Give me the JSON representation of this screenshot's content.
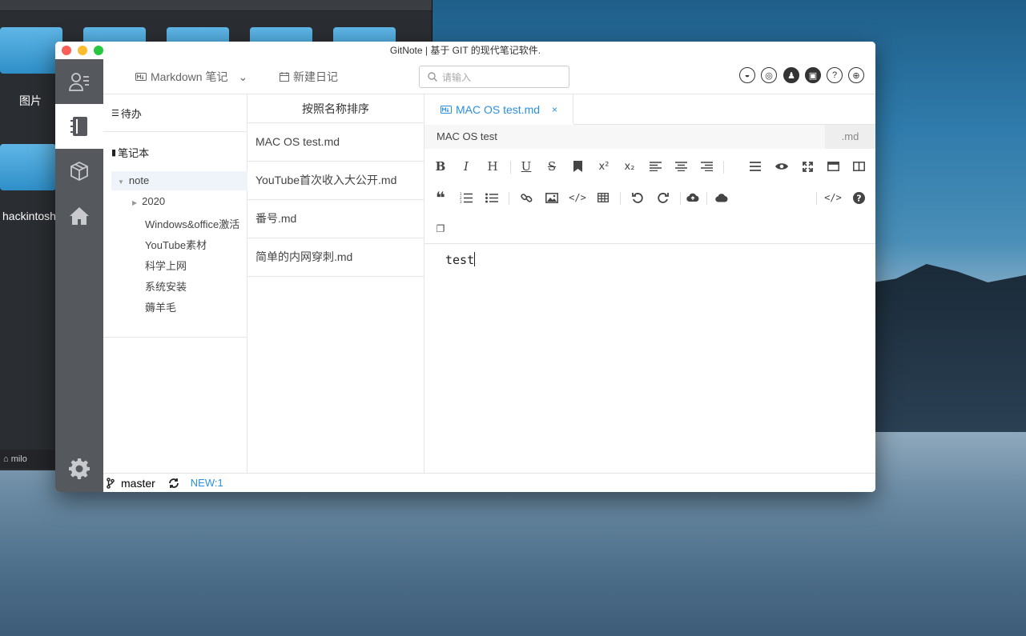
{
  "desktop": {
    "folder_labels": [
      "图片",
      "hackintosh"
    ],
    "finder_path": "milo"
  },
  "window": {
    "title": "GitNote | 基于 GIT 的现代笔记软件."
  },
  "header": {
    "markdown_label": "Markdown 笔记",
    "new_diary_label": "新建日记",
    "search_placeholder": "请输入"
  },
  "sidebar_left": {
    "todo_label": "待办",
    "notebook_label": "笔记本",
    "tree": [
      {
        "label": "note",
        "level": 0,
        "expanded": true
      },
      {
        "label": "2020",
        "level": 1,
        "collapsed": true
      },
      {
        "label": "Windows&office激活",
        "level": 1
      },
      {
        "label": "YouTube素材",
        "level": 1
      },
      {
        "label": "科学上网",
        "level": 1
      },
      {
        "label": "系统安装",
        "level": 1
      },
      {
        "label": "薅羊毛",
        "level": 1
      }
    ]
  },
  "note_list": {
    "sort_label": "按照名称排序",
    "items": [
      "MAC OS test.md",
      "YouTube首次收入大公开.md",
      "番号.md",
      "简单的内网穿刺.md"
    ]
  },
  "editor": {
    "tab_label": "MAC OS test.md",
    "tab_close": "×",
    "title_value": "MAC OS test",
    "extension": ".md",
    "content": "test",
    "toolbar_row1_text": {
      "bold": "B",
      "italic": "I",
      "heading": "H",
      "underline": "U",
      "strike": "S",
      "superscript": "x²",
      "subscript": "x₂"
    }
  },
  "statusbar": {
    "branch": "master",
    "new_count": "NEW:1"
  },
  "colors": {
    "accent": "#2a90e0",
    "sidebar": "#55585d"
  }
}
